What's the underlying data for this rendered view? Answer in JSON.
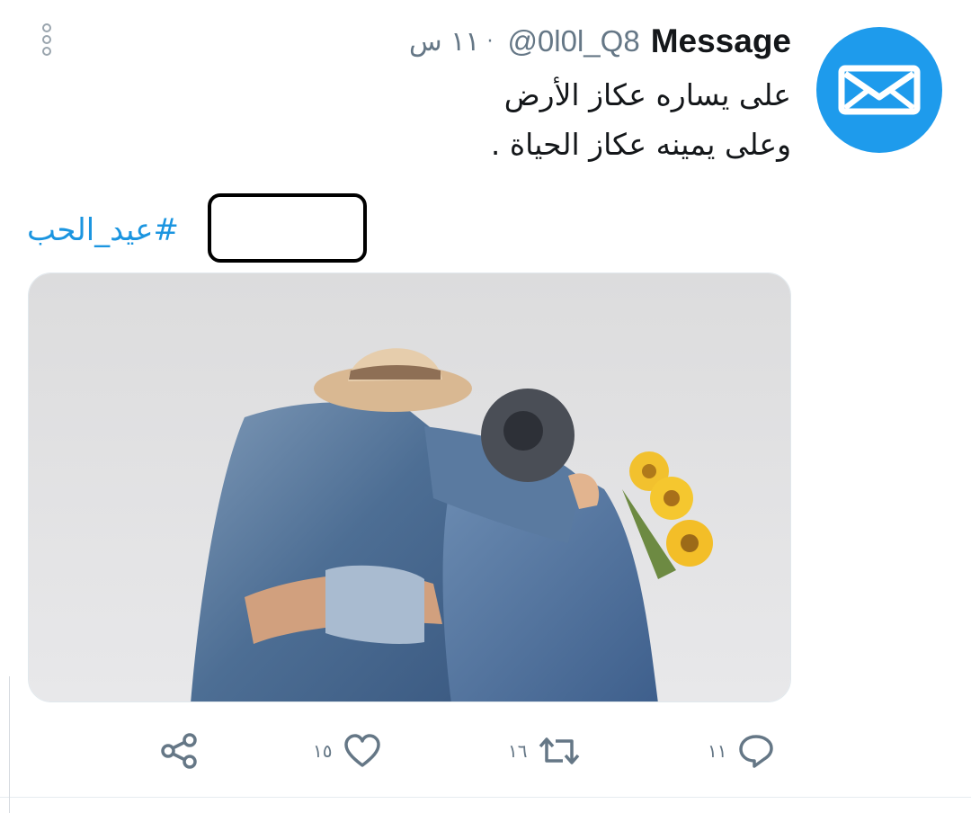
{
  "tweet": {
    "display_name": "Message",
    "handle": "@0l0l_Q8",
    "separator": "·",
    "time": "١١ س",
    "text_lines": [
      "على يساره عكاز الأرض",
      "وعلى يمينه عكاز الحياة ."
    ],
    "hashtag": "#عيد_الحب",
    "avatar_icon": "envelope-icon",
    "avatar_color": "#1e9bec",
    "link_color": "#1b95e0"
  },
  "actions": {
    "reply": {
      "icon": "reply-icon",
      "count": "١١"
    },
    "retweet": {
      "icon": "retweet-icon",
      "count": "١٦"
    },
    "like": {
      "icon": "heart-icon",
      "count": "١٥"
    },
    "share": {
      "icon": "share-icon"
    }
  }
}
